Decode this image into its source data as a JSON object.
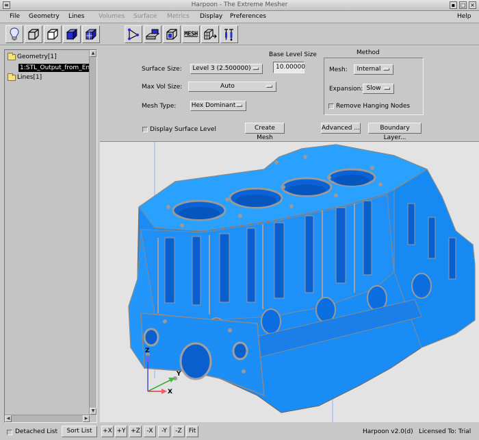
{
  "window": {
    "title": "Harpoon - The Extreme Mesher"
  },
  "menu": {
    "file": "File",
    "geometry": "Geometry",
    "lines": "Lines",
    "volumes": "Volumes",
    "surface": "Surface",
    "metrics": "Metrics",
    "display": "Display",
    "preferences": "Preferences",
    "help": "Help"
  },
  "toolbar": {
    "mesh_label": "MESH"
  },
  "tree": {
    "geometry": "Geometry[1]",
    "stl_item": "1:STL_Output_from_En",
    "lines": "Lines[1]"
  },
  "settings": {
    "base_level_size_label": "Base Level Size",
    "base_level_size_value": "10.00000",
    "surface_size_label": "Surface  Size:",
    "surface_size_value": "Level 3 (2.500000)",
    "max_vol_size_label": "Max Vol  Size:",
    "max_vol_size_value": "Auto",
    "mesh_type_label": "Mesh Type:",
    "mesh_type_value": "Hex Dominant",
    "display_surface_level": "Display Surface Level",
    "create_mesh": "Create Mesh",
    "advanced": "Advanced ...",
    "boundary_layer": "Boundary Layer..."
  },
  "method": {
    "title": "Method",
    "mesh_label": "Mesh:",
    "mesh_value": "Internal",
    "expansion_label": "Expansion:",
    "expansion_value": "Slow",
    "remove_hanging_nodes": "Remove Hanging Nodes"
  },
  "axes": {
    "x": "X",
    "y": "Y",
    "z": "Z"
  },
  "colors": {
    "model": "#1a8cf5",
    "model_edge": "#9a9a9a",
    "viewport_bg": "#e3e3e3",
    "window_bg": "#c8c8c8"
  },
  "status": {
    "detached_list": "Detached List",
    "sort_list": "Sort List",
    "view_px": "+X",
    "view_py": "+Y",
    "view_pz": "+Z",
    "view_nx": "-X",
    "view_ny": "-Y",
    "view_nz": "-Z",
    "fit": "Fit",
    "version": "Harpoon v2.0(d)",
    "license": "Licensed To: Trial"
  }
}
